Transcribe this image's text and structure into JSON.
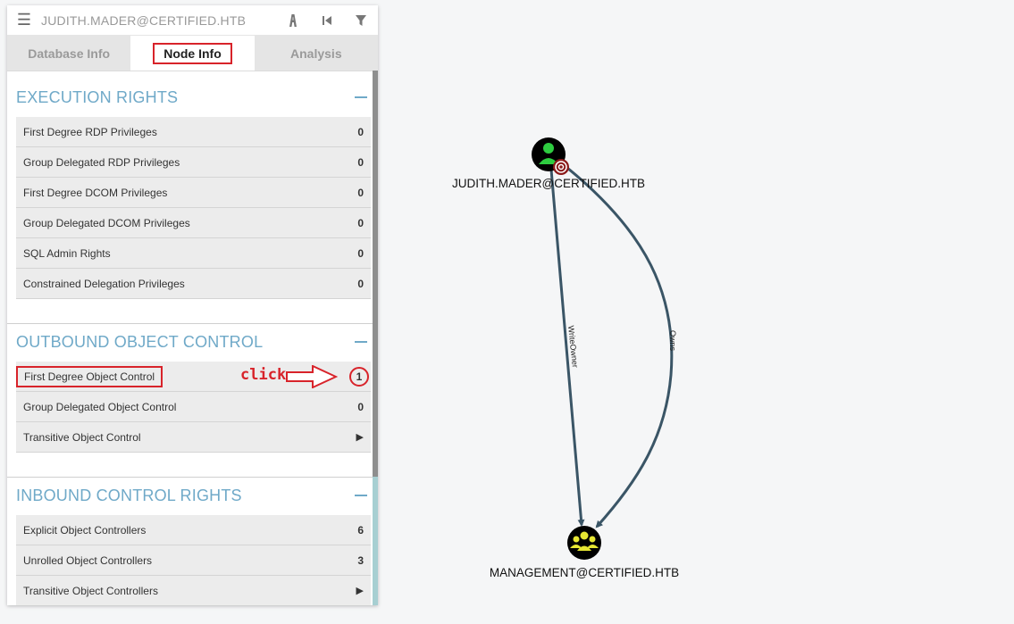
{
  "header": {
    "search_value": "JUDITH.MADER@CERTIFIED.HTB"
  },
  "tabs": [
    {
      "label": "Database Info"
    },
    {
      "label": "Node Info"
    },
    {
      "label": "Analysis"
    }
  ],
  "sections": {
    "execution": {
      "title": "EXECUTION RIGHTS",
      "rows": [
        {
          "label": "First Degree RDP Privileges",
          "value": "0"
        },
        {
          "label": "Group Delegated RDP Privileges",
          "value": "0"
        },
        {
          "label": "First Degree DCOM Privileges",
          "value": "0"
        },
        {
          "label": "Group Delegated DCOM Privileges",
          "value": "0"
        },
        {
          "label": "SQL Admin Rights",
          "value": "0"
        },
        {
          "label": "Constrained Delegation Privileges",
          "value": "0"
        }
      ]
    },
    "outbound": {
      "title": "OUTBOUND OBJECT CONTROL",
      "rows": [
        {
          "label": "First Degree Object Control",
          "value": "1"
        },
        {
          "label": "Group Delegated Object Control",
          "value": "0"
        },
        {
          "label": "Transitive Object Control",
          "value": ""
        }
      ]
    },
    "inbound": {
      "title": "INBOUND CONTROL RIGHTS",
      "rows": [
        {
          "label": "Explicit Object Controllers",
          "value": "6"
        },
        {
          "label": "Unrolled Object Controllers",
          "value": "3"
        },
        {
          "label": "Transitive Object Controllers",
          "value": ""
        }
      ]
    }
  },
  "annotation": {
    "click_text": "click",
    "color": "#d8232a"
  },
  "graph": {
    "nodes": [
      {
        "label": "JUDITH.MADER@CERTIFIED.HTB",
        "type": "user-icon",
        "color": "#2ecc40"
      },
      {
        "label": "MANAGEMENT@CERTIFIED.HTB",
        "type": "group-icon",
        "color": "#e6e633"
      }
    ],
    "edges": [
      {
        "label": "WriteOwner"
      },
      {
        "label": "Owns"
      }
    ],
    "edge_color": "#3a5566"
  }
}
